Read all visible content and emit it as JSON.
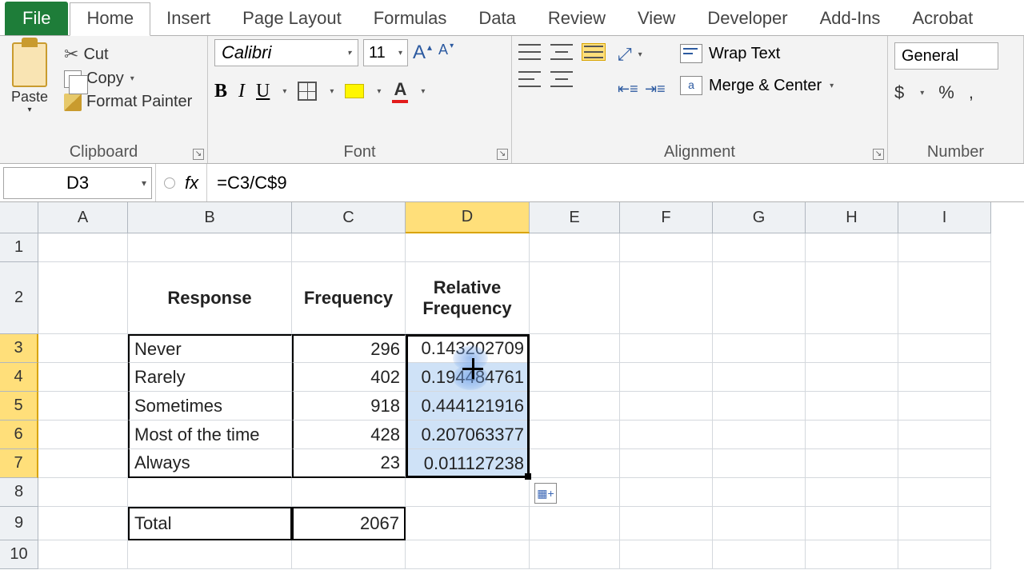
{
  "tabs": {
    "file": "File",
    "home": "Home",
    "insert": "Insert",
    "page_layout": "Page Layout",
    "formulas": "Formulas",
    "data": "Data",
    "review": "Review",
    "view": "View",
    "developer": "Developer",
    "addins": "Add-Ins",
    "acrobat": "Acrobat"
  },
  "ribbon": {
    "clipboard": {
      "label": "Clipboard",
      "paste": "Paste",
      "cut": "Cut",
      "copy": "Copy",
      "format_painter": "Format Painter"
    },
    "font": {
      "label": "Font",
      "name": "Calibri",
      "size": "11",
      "bold": "B",
      "italic": "I",
      "underline": "U",
      "font_color_letter": "A"
    },
    "alignment": {
      "label": "Alignment",
      "wrap": "Wrap Text",
      "merge": "Merge & Center"
    },
    "number": {
      "label": "Number",
      "format": "General",
      "currency": "$",
      "percent": "%",
      "comma": ","
    }
  },
  "formula_bar": {
    "name_box": "D3",
    "fx": "fx",
    "formula": "=C3/C$9"
  },
  "columns": [
    "A",
    "B",
    "C",
    "D",
    "E",
    "F",
    "G",
    "H",
    "I"
  ],
  "rows": [
    "1",
    "2",
    "3",
    "4",
    "5",
    "6",
    "7",
    "8",
    "9",
    "10"
  ],
  "table": {
    "headers": {
      "response": "Response",
      "frequency": "Frequency",
      "rel_freq": "Relative Frequency"
    },
    "rows": [
      {
        "response": "Never",
        "frequency": "296",
        "rel": "0.143202709"
      },
      {
        "response": "Rarely",
        "frequency": "402",
        "rel": "0.194484761"
      },
      {
        "response": "Sometimes",
        "frequency": "918",
        "rel": "0.444121916"
      },
      {
        "response": "Most of the time",
        "frequency": "428",
        "rel": "0.207063377"
      },
      {
        "response": "Always",
        "frequency": "23",
        "rel": "0.011127238"
      }
    ],
    "total_label": "Total",
    "total_value": "2067"
  },
  "chart_data": {
    "type": "table",
    "title": "Relative Frequency",
    "columns": [
      "Response",
      "Frequency",
      "Relative Frequency"
    ],
    "rows": [
      [
        "Never",
        296,
        0.143202709
      ],
      [
        "Rarely",
        402,
        0.194484761
      ],
      [
        "Sometimes",
        918,
        0.444121916
      ],
      [
        "Most of the time",
        428,
        0.207063377
      ],
      [
        "Always",
        23,
        0.011127238
      ]
    ],
    "total": [
      "Total",
      2067
    ]
  }
}
